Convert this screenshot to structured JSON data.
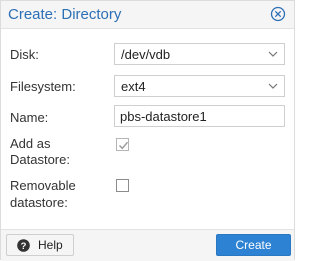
{
  "dialog": {
    "title": "Create: Directory",
    "close_icon": "close-circle-icon"
  },
  "form": {
    "disk": {
      "label": "Disk:",
      "value": "/dev/vdb"
    },
    "filesystem": {
      "label": "Filesystem:",
      "value": "ext4"
    },
    "name": {
      "label": "Name:",
      "value": "pbs-datastore1"
    },
    "add_as_datastore": {
      "label_line1": "Add as",
      "label_line2": "Datastore:",
      "checked": true
    },
    "removable_datastore": {
      "label_line1": "Removable",
      "label_line2": "datastore:",
      "checked": false
    }
  },
  "footer": {
    "help_label": "Help",
    "help_icon": "question-circle-icon",
    "create_label": "Create"
  },
  "colors": {
    "accent": "#2d82d4",
    "title": "#2d6fb5"
  }
}
